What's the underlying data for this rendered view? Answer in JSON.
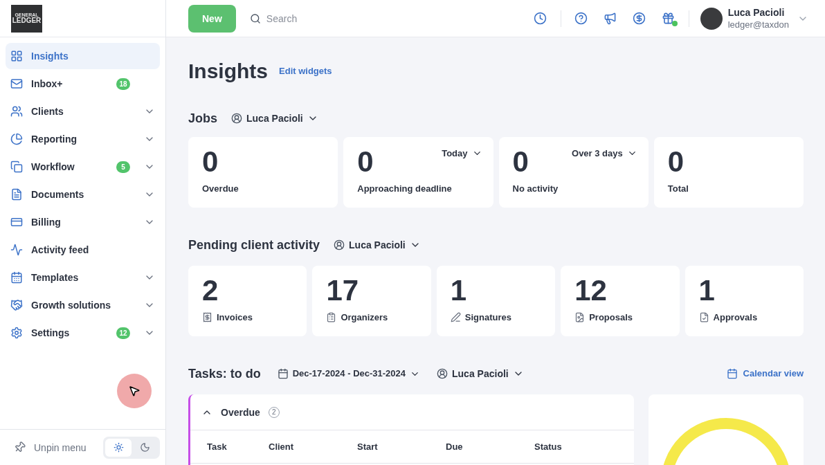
{
  "logo": {
    "line_1": "GENERAL",
    "line_2": "LEDGER"
  },
  "sidebar": {
    "items": [
      {
        "label": "Insights",
        "selected": true,
        "collapsible": false
      },
      {
        "label": "Inbox+",
        "selected": false,
        "badge": "18",
        "collapsible": false
      },
      {
        "label": "Clients",
        "selected": false,
        "collapsible": true
      },
      {
        "label": "Reporting",
        "selected": false,
        "collapsible": true
      },
      {
        "label": "Workflow",
        "selected": false,
        "badge": "5",
        "collapsible": true
      },
      {
        "label": "Documents",
        "selected": false,
        "collapsible": true
      },
      {
        "label": "Billing",
        "selected": false,
        "collapsible": true
      },
      {
        "label": "Activity feed",
        "selected": false,
        "collapsible": false
      },
      {
        "label": "Templates",
        "selected": false,
        "collapsible": true
      },
      {
        "label": "Growth solutions",
        "selected": false,
        "collapsible": true
      },
      {
        "label": "Settings",
        "selected": false,
        "badge": "12",
        "collapsible": true
      }
    ],
    "unpin": "Unpin menu",
    "theme_toggle": [
      {
        "selected": true
      },
      {
        "selected": false
      }
    ]
  },
  "header": {
    "new_button": "New",
    "search": {
      "placeholder": "Search"
    },
    "toolbar_icons": [
      {
        "dot": false
      },
      {
        "dot": false
      },
      {
        "dot": false
      },
      {
        "dot": false
      },
      {
        "dot": true
      }
    ],
    "user": {
      "name": "Luca Pacioli",
      "email": "ledger@taxdon"
    }
  },
  "page": {
    "title": "Insights",
    "edit_link": "Edit widgets"
  },
  "jobs": {
    "title": "Jobs",
    "filter": "Luca Pacioli",
    "cards": [
      {
        "value": "0",
        "label": "Overdue"
      },
      {
        "value": "0",
        "label": "Approaching deadline",
        "dropdown": "Today"
      },
      {
        "value": "0",
        "label": "No activity",
        "dropdown": "Over 3 days"
      },
      {
        "value": "0",
        "label": "Total"
      }
    ]
  },
  "pending": {
    "title": "Pending client activity",
    "filter": "Luca Pacioli",
    "cards": [
      {
        "value": "2",
        "label": "Invoices"
      },
      {
        "value": "17",
        "label": "Organizers"
      },
      {
        "value": "1",
        "label": "Signatures"
      },
      {
        "value": "12",
        "label": "Proposals"
      },
      {
        "value": "1",
        "label": "Approvals"
      }
    ]
  },
  "tasks": {
    "title": "Tasks: to do",
    "date_range": "Dec-17-2024 - Dec-31-2024",
    "filter": "Luca Pacioli",
    "calendar_link": "Calendar view",
    "group": {
      "label": "Overdue",
      "count": "2",
      "expanded": true
    },
    "columns": [
      "Task",
      "Client",
      "Start",
      "Due",
      "Status"
    ]
  }
}
